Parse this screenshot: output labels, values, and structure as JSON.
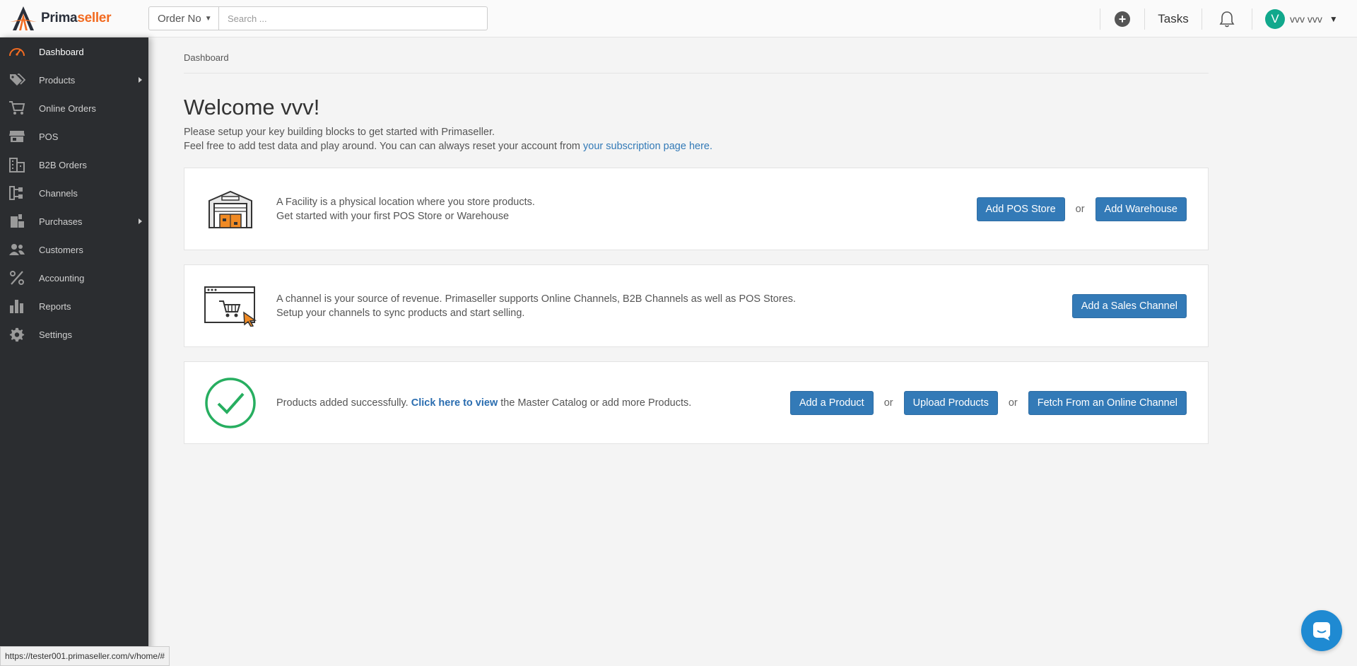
{
  "brand": {
    "part1": "Prima",
    "part2": "seller",
    "accent": "#f26b21"
  },
  "search": {
    "scope_label": "Order No",
    "placeholder": "Search ..."
  },
  "header": {
    "tasks_label": "Tasks",
    "avatar_initial": "V",
    "user_name": "vvv vvv"
  },
  "sidebar": {
    "items": [
      {
        "label": "Dashboard",
        "icon": "speedometer-icon",
        "active": true
      },
      {
        "label": "Products",
        "icon": "tags-icon",
        "has_submenu": true
      },
      {
        "label": "Online Orders",
        "icon": "cart-icon"
      },
      {
        "label": "POS",
        "icon": "store-icon"
      },
      {
        "label": "B2B Orders",
        "icon": "building-icon"
      },
      {
        "label": "Channels",
        "icon": "channels-icon"
      },
      {
        "label": "Purchases",
        "icon": "purchases-icon",
        "has_submenu": true
      },
      {
        "label": "Customers",
        "icon": "users-icon"
      },
      {
        "label": "Accounting",
        "icon": "percent-icon"
      },
      {
        "label": "Reports",
        "icon": "bar-chart-icon"
      },
      {
        "label": "Settings",
        "icon": "gear-icon"
      }
    ]
  },
  "main": {
    "breadcrumb": "Dashboard",
    "welcome": "Welcome vvv!",
    "intro_line1": "Please setup your key building blocks to get started with Primaseller.",
    "intro_line2": "Feel free to add test data and play around. You can can always reset your account from ",
    "intro_link": "your subscription page here."
  },
  "cards": {
    "facility": {
      "line1": "A Facility is a physical location where you store products.",
      "line2": "Get started with your first POS Store or Warehouse",
      "btn1": "Add POS Store",
      "or": "or",
      "btn2": "Add Warehouse"
    },
    "channel": {
      "line1": "A channel is your source of revenue. Primaseller supports Online Channels, B2B Channels as well as POS Stores.",
      "line2": "Setup your channels to sync products and start selling.",
      "btn1": "Add a Sales Channel"
    },
    "products": {
      "text_before": "Products added successfully. ",
      "link": "Click here to view",
      "text_after": " the Master Catalog or add more Products.",
      "btn1": "Add a Product",
      "or1": "or",
      "btn2": "Upload Products",
      "or2": "or",
      "btn3": "Fetch From an Online Channel"
    }
  },
  "statusbar": {
    "url": "https://tester001.primaseller.com/v/home/#"
  }
}
